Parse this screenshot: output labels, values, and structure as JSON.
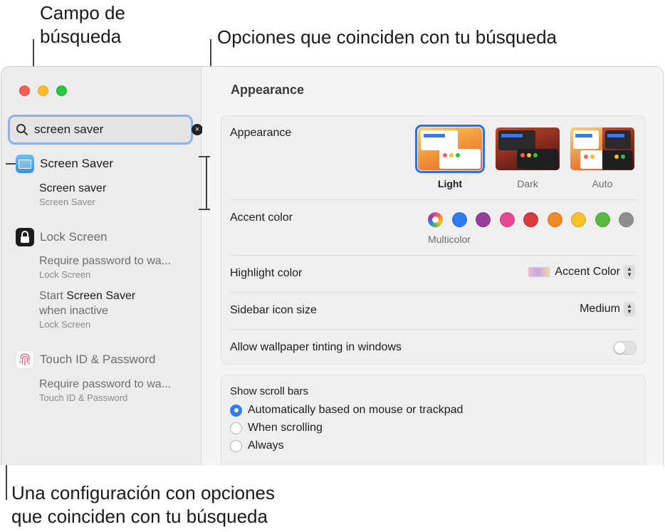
{
  "callouts": {
    "search_field": [
      "Campo de",
      "búsqueda"
    ],
    "matching_options": "Opciones que coinciden con tu búsqueda",
    "setting_with_options": [
      "Una configuración con opciones",
      "que coinciden con tu búsqueda"
    ]
  },
  "sidebar": {
    "search": {
      "value": "screen saver",
      "clear_glyph": "×"
    },
    "results": [
      {
        "label": "Screen Saver",
        "icon": "screen-saver-icon",
        "dimmed": false,
        "matches": [
          {
            "title": "Screen saver",
            "sub": "Screen Saver"
          }
        ]
      },
      {
        "label": "Lock Screen",
        "icon": "lock-icon",
        "dimmed": true,
        "matches": [
          {
            "title": "Require password to wa...",
            "sub": "Lock Screen"
          },
          {
            "title_prefix": "Start ",
            "title_highlight": "Screen Saver",
            "title_line2": "when inactive",
            "sub": "Lock Screen"
          }
        ]
      },
      {
        "label": "Touch ID & Password",
        "icon": "fingerprint-icon",
        "dimmed": true,
        "matches": [
          {
            "title": "Require password to wa...",
            "sub": "Touch ID & Password"
          }
        ]
      }
    ]
  },
  "main": {
    "title": "Appearance",
    "appearance": {
      "label": "Appearance",
      "options": [
        {
          "label": "Light",
          "selected": true
        },
        {
          "label": "Dark",
          "selected": false
        },
        {
          "label": "Auto",
          "selected": false
        }
      ]
    },
    "accent": {
      "label": "Accent color",
      "selected_label": "Multicolor",
      "colors": [
        "multicolor",
        "#2f7cf6",
        "#953e9a",
        "#e5488f",
        "#d93a3a",
        "#f08a24",
        "#f6c229",
        "#5ab845",
        "#8e8e8e"
      ]
    },
    "highlight": {
      "label": "Highlight color",
      "value": "Accent Color"
    },
    "sidebar_icon_size": {
      "label": "Sidebar icon size",
      "value": "Medium"
    },
    "wallpaper_tinting": {
      "label": "Allow wallpaper tinting in windows",
      "on": false
    },
    "scroll_bars": {
      "label": "Show scroll bars",
      "options": [
        {
          "label": "Automatically based on mouse or trackpad",
          "selected": true
        },
        {
          "label": "When scrolling",
          "selected": false
        },
        {
          "label": "Always",
          "selected": false
        }
      ]
    }
  }
}
